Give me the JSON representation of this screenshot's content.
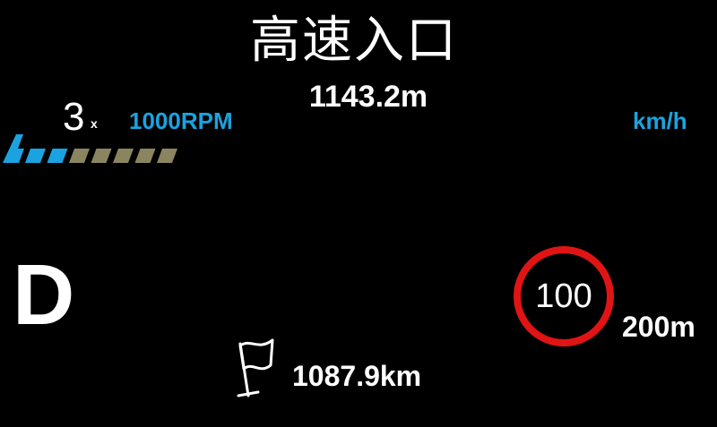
{
  "destination": {
    "name": "高速入口",
    "distance": "1143.2m"
  },
  "transmission": {
    "gear_number": "3",
    "gear_suffix": "x",
    "mode": "D"
  },
  "engine": {
    "rpm_label": "1000RPM",
    "rpm_active_segments": 3,
    "rpm_total_segments": 8
  },
  "speed": {
    "unit": "km/h"
  },
  "speed_limit": {
    "value": "100",
    "distance": "200m"
  },
  "trip": {
    "remaining": "1087.9km",
    "icon": "flag-icon"
  },
  "colors": {
    "accent": "#1aa3e0",
    "rpm_active": "#1aa3e0",
    "rpm_inactive": "#8a8560",
    "limit_ring": "#e01414",
    "text": "#ffffff",
    "background": "#000000"
  }
}
